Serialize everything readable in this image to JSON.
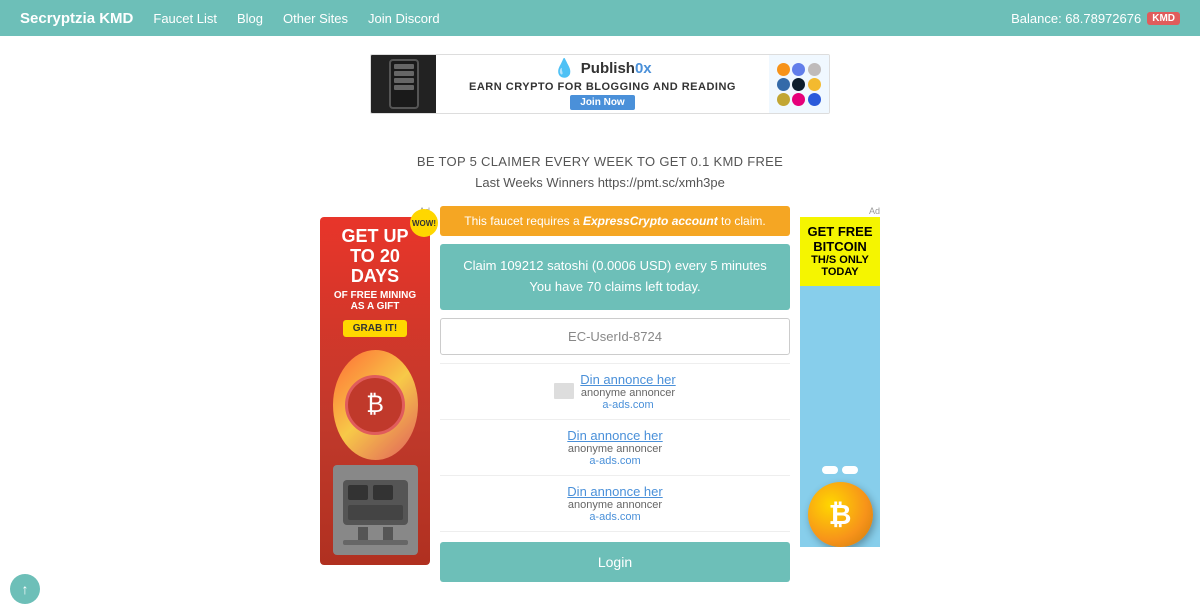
{
  "header": {
    "brand": "Secryptzia KMD",
    "nav": [
      "Faucet List",
      "Blog",
      "Other Sites",
      "Join Discord"
    ],
    "balance_label": "Balance: 68.78972676",
    "kmd_badge": "KMD"
  },
  "banner": {
    "logo": "Publish0x",
    "tagline": "EARN CRYPTO FOR BLOGGING AND READING",
    "join_btn": "Join Now"
  },
  "main": {
    "promo_text": "BE TOP 5 CLAIMER EVERY WEEK TO GET 0.1 KMD FREE",
    "winners_text": "Last Weeks Winners https://pmt.sc/xmh3pe",
    "notice": {
      "prefix": "This faucet requires a ",
      "link_text": "ExpressCrypto account",
      "suffix": " to claim."
    },
    "claim_box": {
      "line1": "Claim 109212 satoshi (0.0006 USD) every 5 minutes",
      "line2": "You have 70 claims left today."
    },
    "userid_placeholder": "EC-UserId-8724",
    "ad_slots": [
      {
        "link": "Din annonce her",
        "sub1": "anonyme annoncer",
        "sub2": "a-ads.com"
      },
      {
        "link": "Din annonce her",
        "sub1": "anonyme annoncer",
        "sub2": "a-ads.com"
      },
      {
        "link": "Din annonce her",
        "sub1": "anonyme annoncer",
        "sub2": "a-ads.com"
      }
    ],
    "login_btn": "Login"
  },
  "left_ad": {
    "wow": "WOW!",
    "headline": "GET UP TO 20 DAYS",
    "subtext": "OF FREE MINING AS A GIFT",
    "grab_btn": "GRAB IT!"
  },
  "right_ad": {
    "get_free": "GET FREE BITCOIN",
    "this_only_today": "TH/S ONLY TODAY"
  },
  "bottom_circle": "↑"
}
